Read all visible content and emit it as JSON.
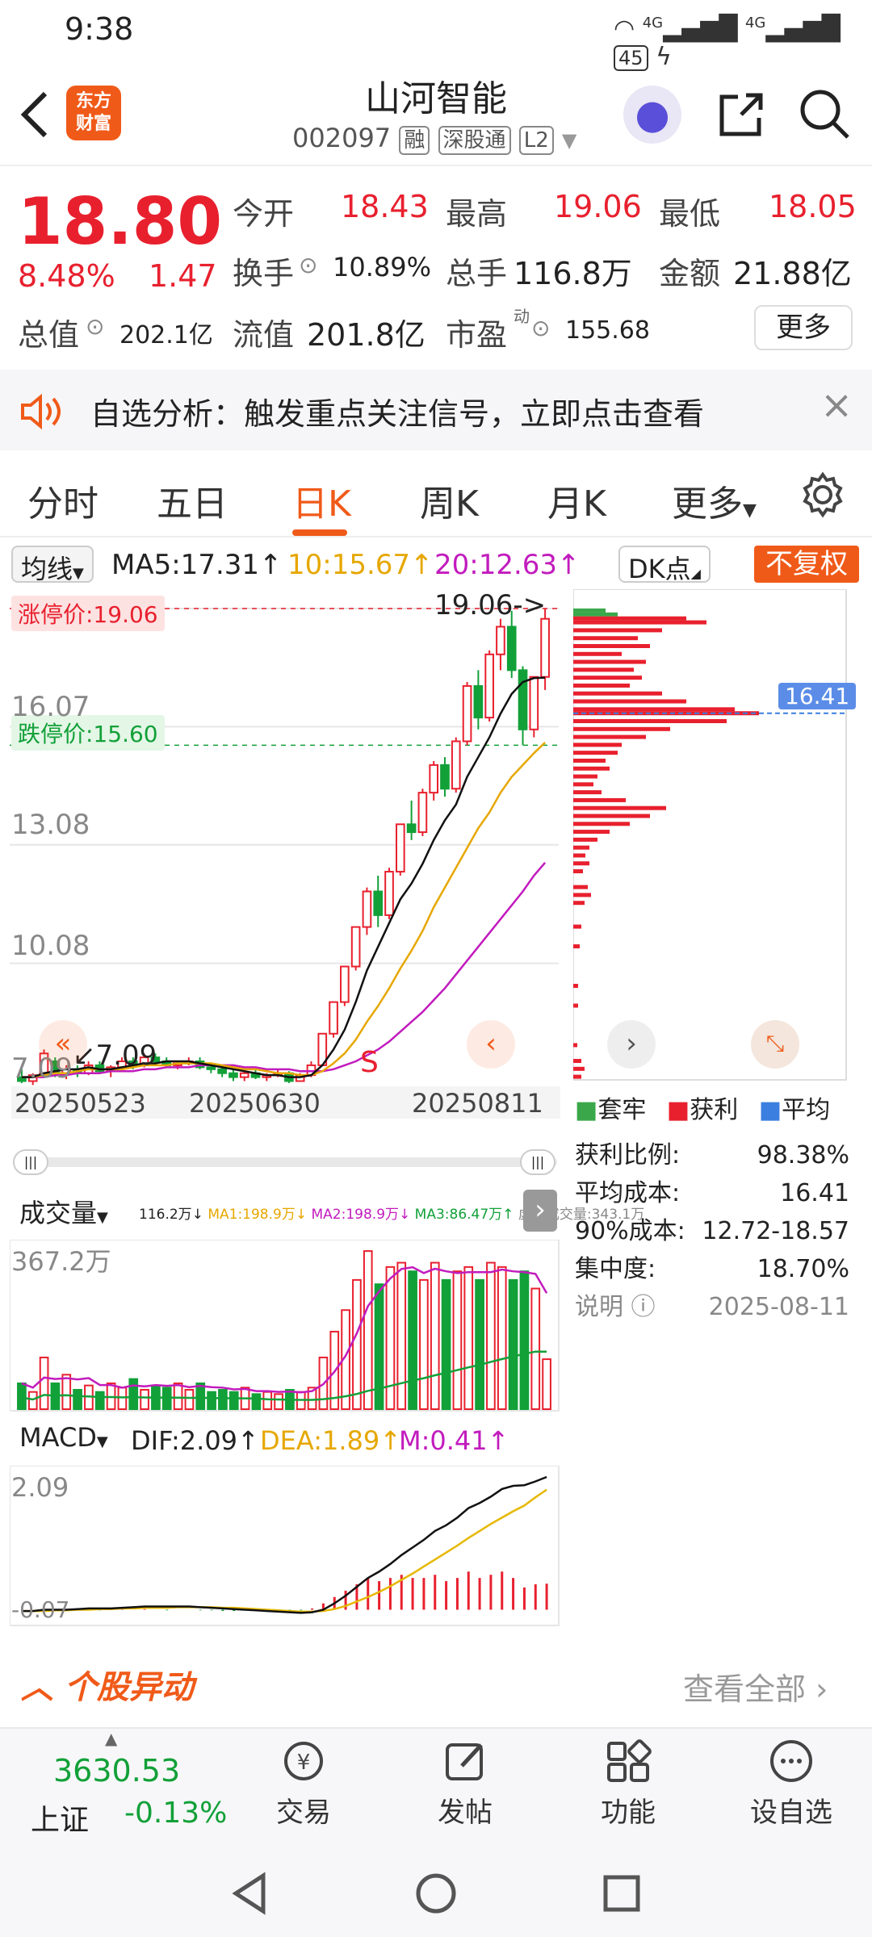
{
  "status": {
    "time": "9:38",
    "network1": "4G",
    "network2": "4G",
    "battery": "45"
  },
  "header": {
    "title": "山河智能",
    "code": "002097",
    "tags": [
      "融",
      "深股通",
      "L2"
    ],
    "logo_line1": "东方",
    "logo_line2": "财富"
  },
  "quote": {
    "price": "18.80",
    "pct": "8.48%",
    "chg": "1.47",
    "open_label": "今开",
    "open": "18.43",
    "high_label": "最高",
    "high": "19.06",
    "low_label": "最低",
    "low": "18.05",
    "turnover_label": "换手",
    "turnover": "10.89%",
    "volume_label": "总手",
    "volume": "116.8万",
    "amount_label": "金额",
    "amount": "21.88亿",
    "mcap_label": "总值",
    "mcap": "202.1亿",
    "float_label": "流值",
    "float": "201.8亿",
    "pe_label": "市盈",
    "pe_sup": "动",
    "pe": "155.68",
    "more": "更多"
  },
  "banner": {
    "text": "自选分析：触发重点关注信号，立即点击查看"
  },
  "tabs": [
    "分时",
    "五日",
    "日K",
    "周K",
    "月K",
    "更多"
  ],
  "kline": {
    "ma_select": "均线",
    "ma5": "MA5:17.31↑",
    "ma10": "10:15.67↑",
    "ma20": "20:12.63↑",
    "dk": "DK点",
    "fq": "不复权",
    "limit_up": "涨停价:19.06",
    "limit_down": "跌停价:15.60",
    "high_mark": "19.06->",
    "low_mark": "7.09",
    "s_mark": "S",
    "y_labels": [
      "16.07",
      "13.08",
      "10.08",
      "7.09"
    ],
    "dates": [
      "20250523",
      "20250630",
      "20250811"
    ]
  },
  "chart_data": {
    "type": "candlestick",
    "ohlc": [
      [
        7.2,
        7.4,
        7.05,
        7.1
      ],
      [
        7.1,
        7.3,
        7.0,
        7.25
      ],
      [
        7.3,
        7.9,
        7.2,
        7.8
      ],
      [
        7.6,
        7.7,
        7.2,
        7.3
      ],
      [
        7.3,
        7.5,
        7.15,
        7.4
      ],
      [
        7.4,
        7.5,
        7.2,
        7.3
      ],
      [
        7.3,
        7.6,
        7.25,
        7.5
      ],
      [
        7.5,
        7.6,
        7.3,
        7.35
      ],
      [
        7.35,
        7.5,
        7.2,
        7.45
      ],
      [
        7.45,
        7.7,
        7.4,
        7.6
      ],
      [
        7.6,
        7.7,
        7.4,
        7.5
      ],
      [
        7.5,
        7.8,
        7.45,
        7.7
      ],
      [
        7.7,
        7.8,
        7.5,
        7.6
      ],
      [
        7.6,
        7.7,
        7.45,
        7.5
      ],
      [
        7.5,
        7.6,
        7.4,
        7.55
      ],
      [
        7.55,
        7.7,
        7.5,
        7.6
      ],
      [
        7.6,
        7.7,
        7.4,
        7.45
      ],
      [
        7.45,
        7.55,
        7.3,
        7.4
      ],
      [
        7.4,
        7.5,
        7.2,
        7.3
      ],
      [
        7.3,
        7.4,
        7.1,
        7.2
      ],
      [
        7.2,
        7.35,
        7.1,
        7.3
      ],
      [
        7.3,
        7.4,
        7.15,
        7.2
      ],
      [
        7.2,
        7.3,
        7.1,
        7.25
      ],
      [
        7.25,
        7.4,
        7.2,
        7.3
      ],
      [
        7.3,
        7.35,
        7.05,
        7.1
      ],
      [
        7.1,
        7.3,
        7.09,
        7.25
      ],
      [
        7.25,
        7.6,
        7.2,
        7.5
      ],
      [
        7.5,
        8.0,
        7.5,
        8.3
      ],
      [
        8.3,
        9.1,
        8.2,
        9.1
      ],
      [
        9.1,
        10.0,
        9.0,
        10.0
      ],
      [
        10.0,
        11.0,
        9.9,
        11.0
      ],
      [
        11.0,
        12.0,
        10.8,
        11.9
      ],
      [
        11.9,
        12.3,
        11.0,
        11.3
      ],
      [
        11.3,
        12.5,
        11.2,
        12.4
      ],
      [
        12.4,
        13.6,
        12.3,
        13.6
      ],
      [
        13.6,
        14.2,
        13.2,
        13.4
      ],
      [
        13.4,
        14.5,
        13.3,
        14.4
      ],
      [
        14.4,
        15.2,
        14.2,
        15.1
      ],
      [
        15.1,
        15.3,
        14.3,
        14.5
      ],
      [
        14.5,
        15.8,
        14.4,
        15.7
      ],
      [
        15.7,
        17.2,
        15.6,
        17.1
      ],
      [
        17.1,
        17.5,
        16.0,
        16.3
      ],
      [
        16.3,
        18.0,
        16.2,
        17.9
      ],
      [
        17.9,
        18.8,
        17.5,
        18.6
      ],
      [
        18.6,
        19.0,
        17.3,
        17.5
      ],
      [
        17.5,
        17.6,
        15.6,
        16.0
      ],
      [
        16.0,
        17.3,
        15.8,
        17.33
      ],
      [
        17.33,
        19.06,
        17.0,
        18.8
      ]
    ],
    "ma5": [
      7.2,
      7.2,
      7.3,
      7.35,
      7.4,
      7.4,
      7.45,
      7.4,
      7.4,
      7.45,
      7.5,
      7.55,
      7.55,
      7.6,
      7.6,
      7.6,
      7.55,
      7.5,
      7.45,
      7.4,
      7.35,
      7.3,
      7.25,
      7.25,
      7.2,
      7.2,
      7.25,
      7.5,
      7.9,
      8.4,
      9.1,
      9.9,
      10.5,
      11.1,
      11.7,
      12.1,
      12.6,
      13.2,
      13.7,
      14.1,
      14.8,
      15.3,
      15.8,
      16.4,
      16.9,
      17.2,
      17.3,
      17.31
    ],
    "ma10": [
      7.2,
      7.2,
      7.25,
      7.3,
      7.3,
      7.35,
      7.4,
      7.4,
      7.4,
      7.4,
      7.45,
      7.5,
      7.5,
      7.5,
      7.55,
      7.55,
      7.55,
      7.55,
      7.5,
      7.45,
      7.4,
      7.4,
      7.35,
      7.3,
      7.3,
      7.25,
      7.25,
      7.35,
      7.55,
      7.8,
      8.15,
      8.6,
      9.0,
      9.45,
      9.95,
      10.4,
      10.9,
      11.5,
      12.0,
      12.5,
      13.0,
      13.5,
      13.9,
      14.4,
      14.8,
      15.1,
      15.4,
      15.67
    ],
    "ma20": [
      7.2,
      7.2,
      7.2,
      7.25,
      7.25,
      7.3,
      7.3,
      7.3,
      7.35,
      7.35,
      7.35,
      7.4,
      7.4,
      7.45,
      7.45,
      7.45,
      7.5,
      7.5,
      7.5,
      7.5,
      7.45,
      7.45,
      7.4,
      7.4,
      7.4,
      7.35,
      7.35,
      7.35,
      7.4,
      7.5,
      7.6,
      7.75,
      7.9,
      8.1,
      8.35,
      8.6,
      8.85,
      9.15,
      9.45,
      9.8,
      10.15,
      10.5,
      10.85,
      11.2,
      11.55,
      11.9,
      12.3,
      12.63
    ],
    "volume": [
      60,
      40,
      120,
      60,
      80,
      45,
      55,
      40,
      60,
      50,
      70,
      45,
      55,
      50,
      60,
      45,
      60,
      40,
      45,
      40,
      50,
      35,
      40,
      35,
      45,
      40,
      50,
      120,
      180,
      230,
      300,
      367,
      290,
      330,
      340,
      320,
      300,
      340,
      300,
      320,
      330,
      300,
      340,
      330,
      300,
      320,
      280,
      116
    ],
    "macd_hist": [
      0.0,
      0.0,
      0.01,
      0.0,
      -0.01,
      0.0,
      0.0,
      -0.01,
      0.0,
      0.01,
      0.0,
      0.01,
      0.0,
      -0.01,
      0.0,
      0.0,
      -0.01,
      -0.01,
      -0.02,
      -0.02,
      -0.01,
      -0.02,
      -0.02,
      -0.01,
      -0.02,
      -0.01,
      0.02,
      0.1,
      0.2,
      0.3,
      0.4,
      0.5,
      0.45,
      0.5,
      0.55,
      0.5,
      0.5,
      0.55,
      0.45,
      0.5,
      0.6,
      0.5,
      0.55,
      0.6,
      0.5,
      0.35,
      0.4,
      0.41
    ],
    "dif": [
      -0.02,
      -0.02,
      0.0,
      0.0,
      0.0,
      0.01,
      0.02,
      0.02,
      0.02,
      0.03,
      0.04,
      0.05,
      0.05,
      0.05,
      0.05,
      0.05,
      0.04,
      0.03,
      0.02,
      0.01,
      0.0,
      -0.01,
      -0.02,
      -0.03,
      -0.04,
      -0.05,
      -0.04,
      0.0,
      0.1,
      0.22,
      0.36,
      0.5,
      0.6,
      0.72,
      0.86,
      0.98,
      1.1,
      1.24,
      1.33,
      1.45,
      1.6,
      1.68,
      1.78,
      1.9,
      1.95,
      1.96,
      2.02,
      2.09
    ],
    "dea": [
      -0.02,
      -0.02,
      -0.02,
      -0.01,
      -0.01,
      0.0,
      0.0,
      0.01,
      0.01,
      0.02,
      0.02,
      0.03,
      0.03,
      0.03,
      0.04,
      0.04,
      0.04,
      0.04,
      0.03,
      0.03,
      0.02,
      0.01,
      0.0,
      -0.01,
      -0.02,
      -0.03,
      -0.03,
      -0.02,
      0.01,
      0.06,
      0.13,
      0.2,
      0.28,
      0.37,
      0.47,
      0.57,
      0.68,
      0.79,
      0.9,
      1.01,
      1.13,
      1.24,
      1.35,
      1.45,
      1.55,
      1.64,
      1.77,
      1.89
    ],
    "chips": [
      {
        "price": 19.0,
        "len": 40,
        "profit": false
      },
      {
        "price": 18.9,
        "len": 55,
        "profit": false
      },
      {
        "price": 18.8,
        "len": 140,
        "profit": true
      },
      {
        "price": 18.7,
        "len": 165,
        "profit": true
      },
      {
        "price": 18.5,
        "len": 110,
        "profit": true
      },
      {
        "price": 18.3,
        "len": 80,
        "profit": true
      },
      {
        "price": 18.1,
        "len": 95,
        "profit": true
      },
      {
        "price": 17.9,
        "len": 60,
        "profit": true
      },
      {
        "price": 17.7,
        "len": 90,
        "profit": true
      },
      {
        "price": 17.5,
        "len": 75,
        "profit": true
      },
      {
        "price": 17.3,
        "len": 85,
        "profit": true
      },
      {
        "price": 17.1,
        "len": 70,
        "profit": true
      },
      {
        "price": 16.9,
        "len": 110,
        "profit": true
      },
      {
        "price": 16.7,
        "len": 140,
        "profit": true
      },
      {
        "price": 16.5,
        "len": 200,
        "profit": true
      },
      {
        "price": 16.4,
        "len": 230,
        "profit": true
      },
      {
        "price": 16.2,
        "len": 190,
        "profit": true
      },
      {
        "price": 16.0,
        "len": 120,
        "profit": true
      },
      {
        "price": 15.8,
        "len": 90,
        "profit": true
      },
      {
        "price": 15.6,
        "len": 60,
        "profit": true
      },
      {
        "price": 15.4,
        "len": 55,
        "profit": true
      },
      {
        "price": 15.2,
        "len": 40,
        "profit": true
      },
      {
        "price": 15.0,
        "len": 45,
        "profit": true
      },
      {
        "price": 14.8,
        "len": 30,
        "profit": true
      },
      {
        "price": 14.6,
        "len": 25,
        "profit": true
      },
      {
        "price": 14.4,
        "len": 35,
        "profit": true
      },
      {
        "price": 14.2,
        "len": 65,
        "profit": true
      },
      {
        "price": 14.0,
        "len": 115,
        "profit": true
      },
      {
        "price": 13.8,
        "len": 95,
        "profit": true
      },
      {
        "price": 13.6,
        "len": 70,
        "profit": true
      },
      {
        "price": 13.4,
        "len": 45,
        "profit": true
      },
      {
        "price": 13.2,
        "len": 30,
        "profit": true
      },
      {
        "price": 13.0,
        "len": 20,
        "profit": true
      },
      {
        "price": 12.8,
        "len": 15,
        "profit": true
      },
      {
        "price": 12.6,
        "len": 20,
        "profit": true
      },
      {
        "price": 12.4,
        "len": 12,
        "profit": true
      },
      {
        "price": 12.0,
        "len": 18,
        "profit": true
      },
      {
        "price": 11.8,
        "len": 22,
        "profit": true
      },
      {
        "price": 11.6,
        "len": 14,
        "profit": true
      },
      {
        "price": 11.0,
        "len": 10,
        "profit": true
      },
      {
        "price": 10.5,
        "len": 8,
        "profit": true
      },
      {
        "price": 9.5,
        "len": 6,
        "profit": true
      },
      {
        "price": 9.0,
        "len": 6,
        "profit": true
      },
      {
        "price": 8.0,
        "len": 5,
        "profit": true
      },
      {
        "price": 7.6,
        "len": 10,
        "profit": true
      },
      {
        "price": 7.4,
        "len": 14,
        "profit": true
      },
      {
        "price": 7.2,
        "len": 10,
        "profit": true
      }
    ],
    "avg_cost": 16.41,
    "ylim": [
      7.09,
      19.06
    ]
  },
  "chipinfo": {
    "legend": [
      "套牢",
      "获利",
      "平均"
    ],
    "avg_line": "16.41",
    "rows": [
      {
        "k": "获利比例:",
        "v": "98.38%"
      },
      {
        "k": "平均成本:",
        "v": "16.41"
      },
      {
        "k": "90%成本:",
        "v": "12.72-18.57"
      },
      {
        "k": "集中度:",
        "v": "18.70%"
      }
    ],
    "note": "说明",
    "date": "2025-08-11"
  },
  "volume_panel": {
    "select": "成交量",
    "ind": "116.2万↓",
    "ma1": "MA1:198.9万↓",
    "ma2": "MA2:198.9万↓",
    "ma3": "MA3:86.47万↑",
    "virt": "虚拟成交量:343.1万",
    "ymax": "367.2万"
  },
  "macd_panel": {
    "select": "MACD",
    "dif": "DIF:2.09↑",
    "dea": "DEA:1.89↑",
    "m": "M:0.41↑",
    "ymax": "2.09",
    "ymin": "-0.07"
  },
  "news": {
    "title": "个股异动",
    "more": "查看全部"
  },
  "bottom": {
    "index_value": "3630.53",
    "index_name": "上证",
    "index_chg": "-0.13%",
    "buttons": [
      "交易",
      "发帖",
      "功能",
      "设自选"
    ]
  }
}
